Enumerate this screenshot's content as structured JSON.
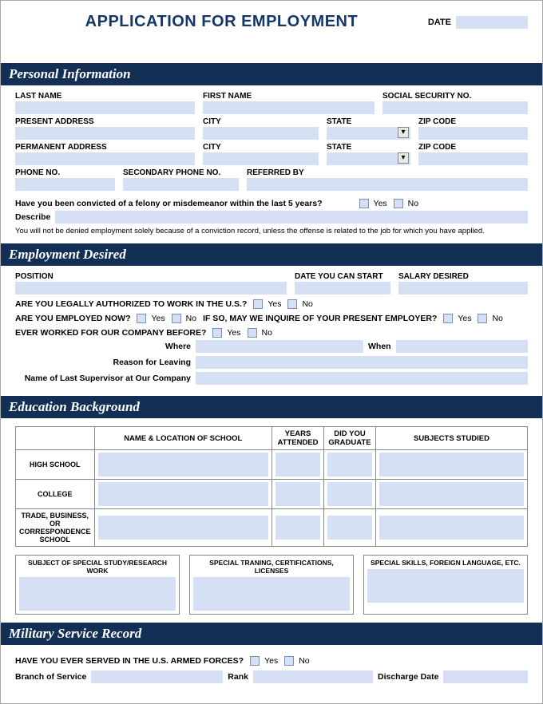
{
  "header": {
    "title": "APPLICATION FOR EMPLOYMENT",
    "date_label": "DATE"
  },
  "yn": {
    "yes": "Yes",
    "no": "No"
  },
  "personal": {
    "heading": "Personal Information",
    "last_name": "LAST NAME",
    "first_name": "FIRST NAME",
    "ssn": "SOCIAL SECURITY NO.",
    "present_address": "PRESENT ADDRESS",
    "city": "CITY",
    "state": "STATE",
    "zip": "ZIP CODE",
    "permanent_address": "PERMANENT ADDRESS",
    "phone": "PHONE NO.",
    "phone2": "SECONDARY PHONE NO.",
    "referred": "REFERRED BY",
    "felony_q": "Have you been convicted of a felony or misdemeanor within the last 5 years?",
    "describe": "Describe",
    "note": "You will not be denied employment solely because of a conviction record, unless the offense is related to the job for which you have applied."
  },
  "employment": {
    "heading": "Employment Desired",
    "position": "POSITION",
    "start": "DATE YOU CAN START",
    "salary": "SALARY DESIRED",
    "authorized_q": "ARE YOU LEGALLY AUTHORIZED TO WORK IN THE U.S.?",
    "employed_q": "ARE YOU EMPLOYED NOW?",
    "inquire_q": "IF SO, MAY WE INQUIRE OF YOUR PRESENT EMPLOYER?",
    "worked_before_q": "EVER WORKED FOR OUR COMPANY BEFORE?",
    "where": "Where",
    "when": "When",
    "reason": "Reason for Leaving",
    "supervisor": "Name of Last Supervisor at Our Company"
  },
  "education": {
    "heading": "Education Background",
    "col_name": "NAME & LOCATION OF SCHOOL",
    "col_years": "YEARS ATTENDED",
    "col_grad": "DID YOU GRADUATE",
    "col_subjects": "SUBJECTS STUDIED",
    "row_hs": "HIGH SCHOOL",
    "row_college": "COLLEGE",
    "row_trade": "TRADE, BUSINESS, OR CORRESPONDENCE SCHOOL",
    "box1": "SUBJECT OF SPECIAL STUDY/RESEARCH WORK",
    "box2": "SPECIAL TRANING, CERTIFICATIONS, LICENSES",
    "box3": "SPECIAL SKILLS, FOREIGN LANGUAGE, ETC."
  },
  "military": {
    "heading": "Military Service Record",
    "served_q": "HAVE YOU EVER SERVED IN THE U.S. ARMED FORCES?",
    "branch": "Branch of Service",
    "rank": "Rank",
    "discharge": "Discharge Date"
  }
}
